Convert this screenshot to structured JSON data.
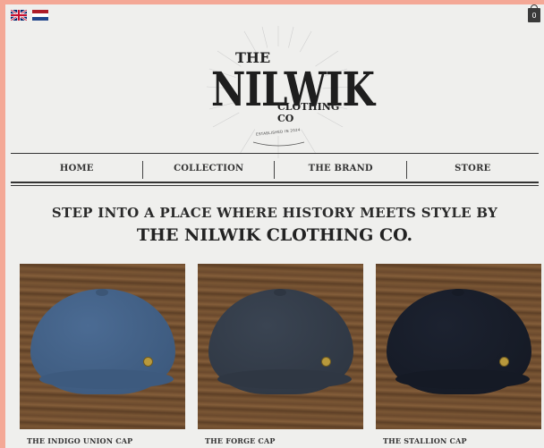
{
  "header": {
    "languages": [
      {
        "code": "en",
        "icon": "uk-flag-icon"
      },
      {
        "code": "nl",
        "icon": "dutch-flag-icon"
      }
    ],
    "cart_count": "0",
    "logo": {
      "the": "THE",
      "name": "NILWIK",
      "sub": "CLOTHING CO",
      "est": "ESTABLISHED IN 2024"
    }
  },
  "nav": {
    "items": [
      "HOME",
      "COLLECTION",
      "THE BRAND",
      "STORE"
    ]
  },
  "hero": {
    "line1": "STEP INTO A PLACE WHERE HISTORY MEETS STYLE BY",
    "line2": "THE NILWIK CLOTHING CO."
  },
  "products": [
    {
      "title": "THE INDIGO UNION CAP",
      "color": "#4b6b93",
      "brim": "#3d5a7e"
    },
    {
      "title": "THE FORGE CAP",
      "color": "#3a4452",
      "brim": "#2f3743"
    },
    {
      "title": "THE STALLION CAP",
      "color": "#1c2230",
      "brim": "#151a25"
    }
  ],
  "colors": {
    "border": "#f4a896",
    "background": "#efefed",
    "text": "#2a2a2a"
  }
}
